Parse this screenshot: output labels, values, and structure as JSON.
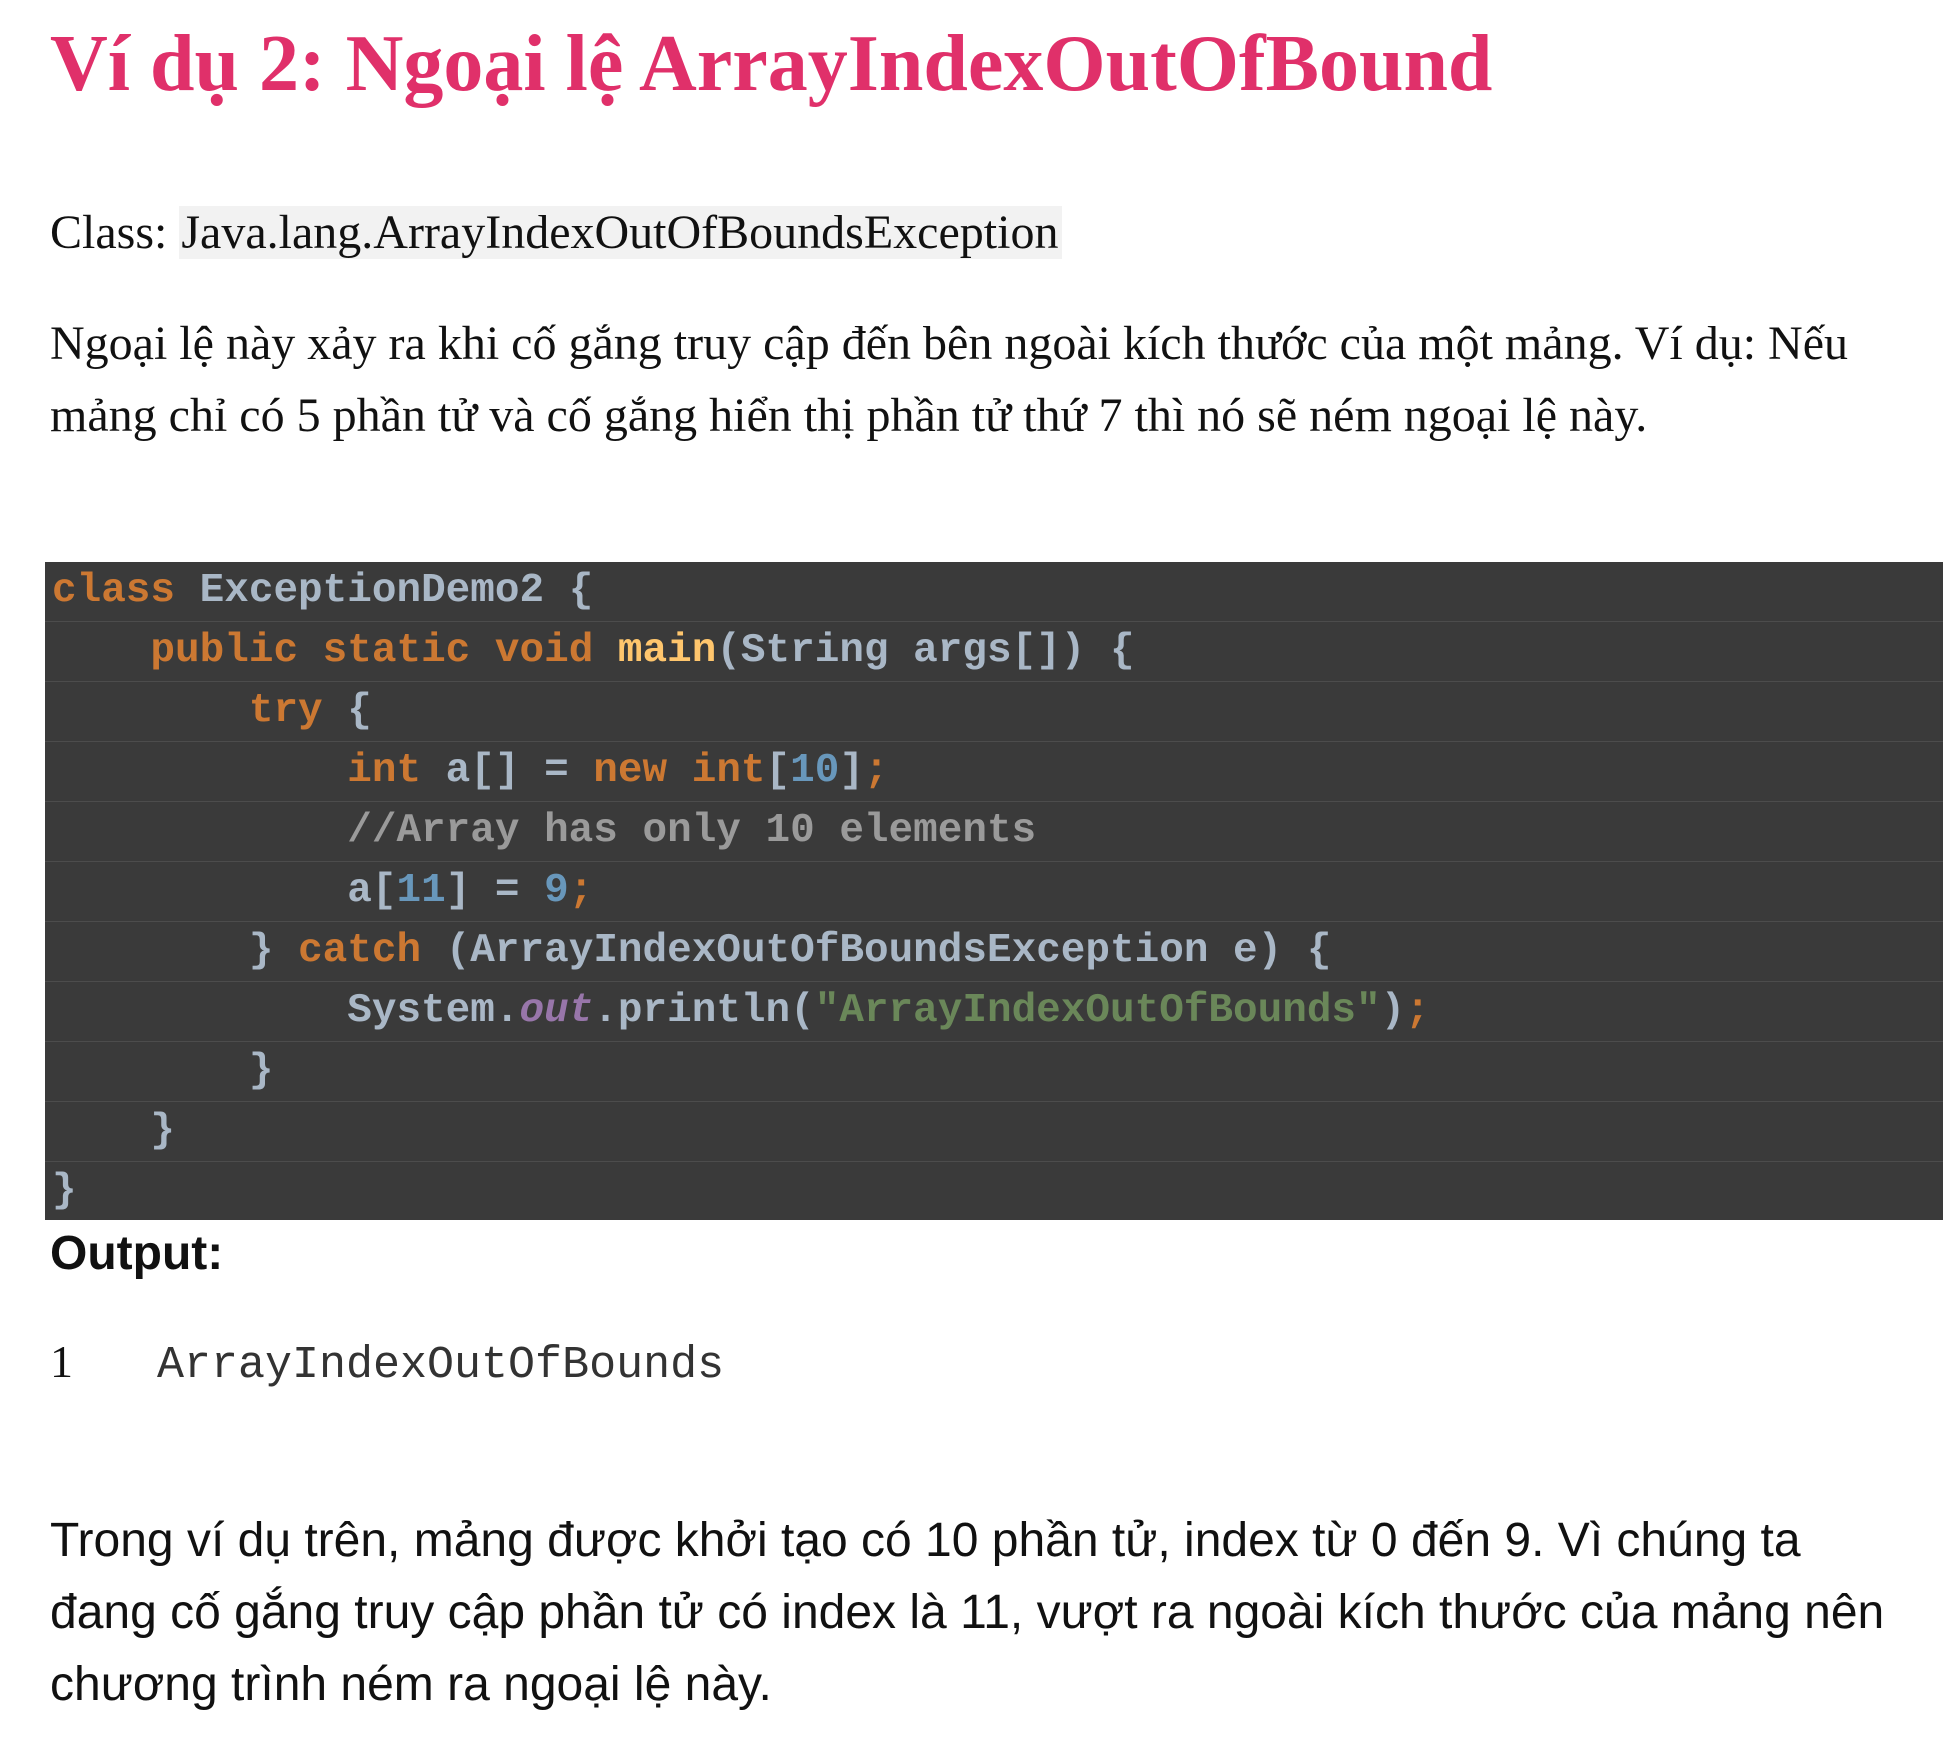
{
  "heading": "Ví dụ 2: Ngoại lệ ArrayIndexOutOfBound",
  "class_info": {
    "label": "Class: ",
    "name": "Java.lang.ArrayIndexOutOfBoundsException"
  },
  "intro_paragraph": "Ngoại lệ này xảy ra khi cố gắng truy cập đến bên ngoài kích thước của một mảng. Ví dụ: Nếu mảng chỉ có 5 phần tử và cố gắng hiển thị phần tử thứ 7 thì nó sẽ ném ngoại lệ này.",
  "code": {
    "line1": {
      "kw": "class",
      "rest": " ExceptionDemo2 {"
    },
    "line2": {
      "indent": "    ",
      "kw": "public static void",
      "fn": "main",
      "rest": "(String args[]) {"
    },
    "line3": {
      "indent": "        ",
      "kw": "try",
      "rest": " {"
    },
    "line4": {
      "indent": "            ",
      "kw1": "int",
      "mid1": " a[] = ",
      "kw2": "new",
      "sp": " ",
      "kw3": "int",
      "open": "[",
      "num": "10",
      "close": "]",
      "semi": ";"
    },
    "line5": {
      "indent": "            ",
      "comment": "//Array has only 10 elements"
    },
    "line6": {
      "indent": "            ",
      "pre": "a[",
      "num1": "11",
      "mid": "] = ",
      "num2": "9",
      "semi": ";"
    },
    "line7": {
      "indent": "        ",
      "pre": "} ",
      "kw": "catch",
      "rest": " (ArrayIndexOutOfBoundsException e) {"
    },
    "line8": {
      "indent": "            ",
      "pre": "System.",
      "field": "out",
      "mid": ".println(",
      "str": "\"ArrayIndexOutOfBounds\"",
      "close": ")",
      "semi": ";"
    },
    "line9": {
      "indent": "        ",
      "text": "}"
    },
    "line10": {
      "indent": "    ",
      "text": "}"
    },
    "line11": {
      "text": "}"
    }
  },
  "output": {
    "label": "Output:",
    "line_number": "1",
    "text": "ArrayIndexOutOfBounds"
  },
  "explanation": "Trong ví dụ trên, mảng được khởi tạo có 10 phần tử, index từ 0 đến 9. Vì chúng ta đang cố gắng truy cập phần tử có index là 11, vượt ra ngoài kích thước của mảng nên chương trình ném ra ngoại lệ này.",
  "colors": {
    "heading": "#e0306a",
    "code_background": "#3a3a3a",
    "keyword": "#cc7832",
    "function": "#ffc66d",
    "number": "#6897bb",
    "string": "#6a8759",
    "plain_code": "#a9b7c6"
  }
}
